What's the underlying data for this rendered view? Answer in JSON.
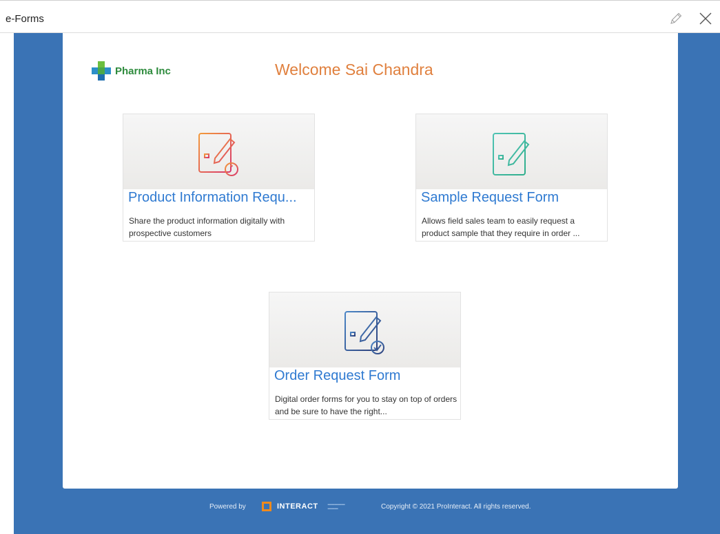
{
  "window": {
    "title": "e-Forms",
    "edit_icon": "pencil-icon",
    "close_icon": "close-icon"
  },
  "header": {
    "logo_text": "Pharma Inc",
    "welcome": "Welcome Sai Chandra"
  },
  "cards": [
    {
      "title": "Product Information Requ...",
      "description": "Share the product information digitally with prospective customers",
      "icon": "form-info-icon",
      "accent": "#e8703a"
    },
    {
      "title": "Sample Request Form",
      "description": "Allows field sales team to easily request a product sample that they require in order ...",
      "icon": "form-edit-icon",
      "accent": "#3dbfa0"
    },
    {
      "title": "Order Request Form",
      "description": "Digital order forms for you to stay on top of orders and be sure to have the right...",
      "icon": "form-check-icon",
      "accent": "#3a5f9e"
    }
  ],
  "footer": {
    "powered_by": "Powered by",
    "brand": "INTERACT",
    "copyright": "Copyright © 2021 ProInteract. All rights reserved."
  },
  "colors": {
    "background_blue": "#3a73b5",
    "welcome_orange": "#e0803e",
    "link_blue": "#2f7ad1",
    "logo_green": "#2e8b3d"
  }
}
